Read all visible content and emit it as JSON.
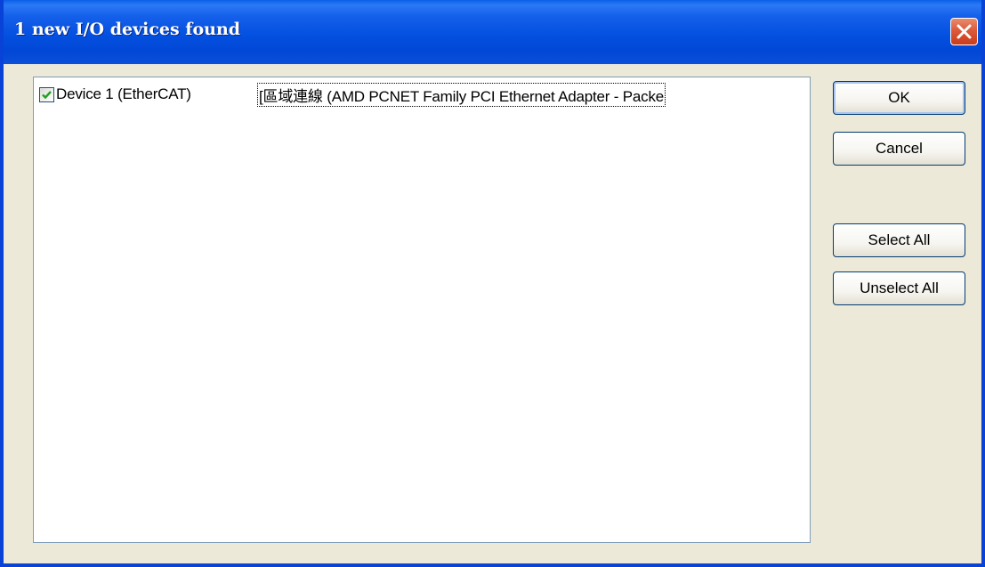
{
  "window": {
    "title": "1 new I/O devices found"
  },
  "device_list": {
    "items": [
      {
        "checked": true,
        "name": "Device 1 (EtherCAT)",
        "description": "[區域連線 (AMD PCNET Family PCI Ethernet Adapter - Packe"
      }
    ]
  },
  "buttons": {
    "ok": "OK",
    "cancel": "Cancel",
    "select_all": "Select All",
    "unselect_all": "Unselect All"
  },
  "colors": {
    "titlebar": "#0450e0",
    "dialog_background": "#ece9d8",
    "close_button": "#dc5a3a",
    "checkmark": "#21a121"
  },
  "icons": {
    "close": "close-icon",
    "check": "checkmark-icon"
  }
}
